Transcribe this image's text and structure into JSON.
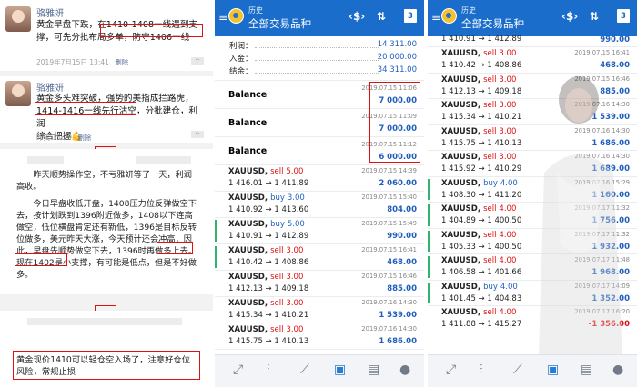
{
  "feed": {
    "post1": {
      "user": "骆雅妍",
      "lines": [
        "黄金早盘下跌，在1410-1408一线遇到支",
        "撑，可先分批布局多单，防守1406一线"
      ],
      "time": "2019年7月15日 13:41",
      "delete": "删除"
    },
    "post2": {
      "user": "骆雅妍",
      "lines": [
        "黄金多头难突破，强势的美指成拦路虎，",
        "1414-1416一线先行沽空，分批建仓，利润",
        "综合把握💪"
      ],
      "time": "昨天 15:29",
      "delete": "删除"
    },
    "card": {
      "para1": "昨天顺势操作空，不亏雅妍等了一天，利润高收。",
      "para2": "今日早盘收低开盘，1408压力位反弹做空下去，按计划跌到1396附近做多，1408以下连高做空，低位横盘肯定还有新低，1396是目标反转位做多，美元昨天大涨，今天预计还会冲高，因此，早盘先顺势做空下去，1396时再做多上去。现在1402是小支撑，有可能是低点，但是不好做多。"
    },
    "card2": "黄金现价1410可以轻仓空入场了，注意好仓位风险，常规止损"
  },
  "app": {
    "title_small": "历史",
    "title_main": "全部交易品种",
    "icon_filter": "⇅",
    "icon_calendar": "3"
  },
  "panel1": {
    "summary": [
      {
        "label": "利润：",
        "value": "14 311.00"
      },
      {
        "label": "入金：",
        "value": "20 000.00"
      },
      {
        "label": "结余：",
        "value": "34 311.00"
      }
    ],
    "balances": [
      {
        "label": "Balance",
        "date": "2019.07.15 11:06",
        "amount": "7 000.00"
      },
      {
        "label": "Balance",
        "date": "2019.07.15 11:09",
        "amount": "7 000.00"
      },
      {
        "label": "Balance",
        "date": "2019.07.15 11:12",
        "amount": "6 000.00"
      }
    ],
    "trades": [
      {
        "sym": "XAUUSD,",
        "side": "sell",
        "lots": "5.00",
        "prices": "1 416.01 → 1 411.89",
        "date": "2019.07.15 14:39",
        "profit": "2 060.00"
      },
      {
        "sym": "XAUUSD,",
        "side": "buy",
        "lots": "3.00",
        "prices": "1 410.92 → 1 413.60",
        "date": "2019.07.15 15:40",
        "profit": "804.00"
      },
      {
        "sym": "XAUUSD,",
        "side": "buy",
        "lots": "5.00",
        "prices": "1 410.91 → 1 412.89",
        "date": "2019.07.15 15:49",
        "profit": "990.00"
      },
      {
        "sym": "XAUUSD,",
        "side": "sell",
        "lots": "3.00",
        "prices": "1 410.42 → 1 408.86",
        "date": "2019.07.15 16:41",
        "profit": "468.00"
      },
      {
        "sym": "XAUUSD,",
        "side": "sell",
        "lots": "3.00",
        "prices": "1 412.13 → 1 409.18",
        "date": "2019.07.15 16:46",
        "profit": "885.00"
      },
      {
        "sym": "XAUUSD,",
        "side": "sell",
        "lots": "3.00",
        "prices": "1 415.34 → 1 410.21",
        "date": "2019.07.16 14:30",
        "profit": "1 539.00"
      },
      {
        "sym": "XAUUSD,",
        "side": "sell",
        "lots": "3.00",
        "prices": "1 415.75 → 1 410.13",
        "date": "2019.07.16 14:30",
        "profit": "1 686.00"
      }
    ]
  },
  "panel2": {
    "top": {
      "prices": "1 410.91 → 1 412.89",
      "profit": "990.00"
    },
    "trades": [
      {
        "sym": "XAUUSD,",
        "side": "sell",
        "lots": "3.00",
        "prices": "1 410.42 → 1 408.86",
        "date": "2019.07.15 16:41",
        "profit": "468.00"
      },
      {
        "sym": "XAUUSD,",
        "side": "sell",
        "lots": "3.00",
        "prices": "1 412.13 → 1 409.18",
        "date": "2019.07.15 16:46",
        "profit": "885.00"
      },
      {
        "sym": "XAUUSD,",
        "side": "sell",
        "lots": "3.00",
        "prices": "1 415.34 → 1 410.21",
        "date": "2019.07.16 14:30",
        "profit": "1 539.00"
      },
      {
        "sym": "XAUUSD,",
        "side": "sell",
        "lots": "3.00",
        "prices": "1 415.75 → 1 410.13",
        "date": "2019.07.16 14:30",
        "profit": "1 686.00"
      },
      {
        "sym": "XAUUSD,",
        "side": "sell",
        "lots": "3.00",
        "prices": "1 415.92 → 1 410.29",
        "date": "2019.07.16 14:30",
        "profit": "1 689.00"
      },
      {
        "sym": "XAUUSD,",
        "side": "buy",
        "lots": "4.00",
        "prices": "1 408.30 → 1 411.20",
        "date": "2019.07.16 15:29",
        "profit": "1 160.00"
      },
      {
        "sym": "XAUUSD,",
        "side": "sell",
        "lots": "4.00",
        "prices": "1 404.89 → 1 400.50",
        "date": "2019.07.17 11:32",
        "profit": "1 756.00"
      },
      {
        "sym": "XAUUSD,",
        "side": "sell",
        "lots": "4.00",
        "prices": "1 405.33 → 1 400.50",
        "date": "2019.07.17 11:32",
        "profit": "1 932.00"
      },
      {
        "sym": "XAUUSD,",
        "side": "sell",
        "lots": "4.00",
        "prices": "1 406.58 → 1 401.66",
        "date": "2019.07.17 11:48",
        "profit": "1 968.00"
      },
      {
        "sym": "XAUUSD,",
        "side": "buy",
        "lots": "4.00",
        "prices": "1 401.45 → 1 404.83",
        "date": "2019.07.17 14:09",
        "profit": "1 352.00"
      },
      {
        "sym": "XAUUSD,",
        "side": "sell",
        "lots": "4.00",
        "prices": "1 411.88 → 1 415.27",
        "date": "2019.07.17 16:20",
        "profit": "-1 356.00"
      }
    ]
  },
  "bottom_tabs": [
    "quotes-icon",
    "chart-icon",
    "trade-icon",
    "history-icon",
    "news-icon",
    "chat-icon"
  ],
  "colors": {
    "appbar": "#1a6dcb",
    "sell": "#dd1111",
    "buy": "#1f5fbe",
    "highlight": "#dd1111"
  }
}
